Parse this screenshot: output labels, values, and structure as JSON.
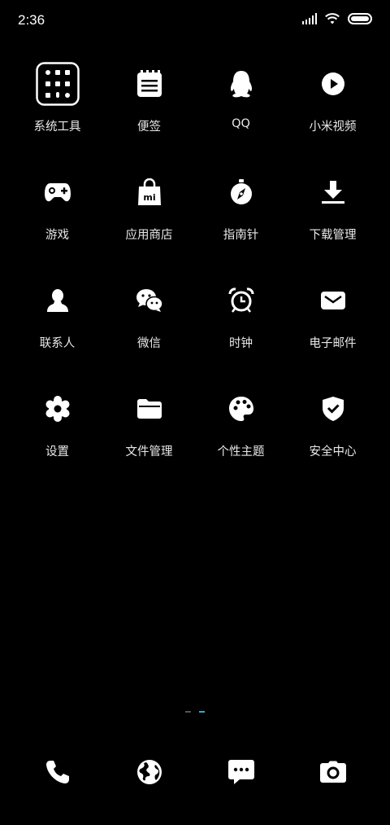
{
  "status_bar": {
    "time": "2:36",
    "signal_icon": "cellular-signal-icon",
    "wifi_icon": "wifi-icon",
    "battery_icon": "battery-icon"
  },
  "apps": [
    {
      "label": "系统工具",
      "icon": "system-tools-folder-icon"
    },
    {
      "label": "便签",
      "icon": "notes-icon"
    },
    {
      "label": "QQ",
      "icon": "qq-penguin-icon"
    },
    {
      "label": "小米视频",
      "icon": "video-play-icon"
    },
    {
      "label": "游戏",
      "icon": "gamepad-icon"
    },
    {
      "label": "应用商店",
      "icon": "app-store-bag-icon"
    },
    {
      "label": "指南针",
      "icon": "compass-icon"
    },
    {
      "label": "下载管理",
      "icon": "download-icon"
    },
    {
      "label": "联系人",
      "icon": "contact-person-icon"
    },
    {
      "label": "微信",
      "icon": "wechat-icon"
    },
    {
      "label": "时钟",
      "icon": "alarm-clock-icon"
    },
    {
      "label": "电子邮件",
      "icon": "mail-envelope-icon"
    },
    {
      "label": "设置",
      "icon": "settings-gear-icon"
    },
    {
      "label": "文件管理",
      "icon": "folder-icon"
    },
    {
      "label": "个性主题",
      "icon": "palette-icon"
    },
    {
      "label": "安全中心",
      "icon": "security-shield-icon"
    }
  ],
  "folder_badge_text": "mi",
  "page_indicator": {
    "pages": 2,
    "active": 2
  },
  "dock": [
    {
      "icon": "phone-icon"
    },
    {
      "icon": "browser-globe-icon"
    },
    {
      "icon": "messages-icon"
    },
    {
      "icon": "camera-icon"
    }
  ],
  "colors": {
    "background": "#000000",
    "text": "#e8e8e8",
    "page_indicator_active": "#3aa5c9",
    "page_indicator_inactive": "#555555"
  }
}
